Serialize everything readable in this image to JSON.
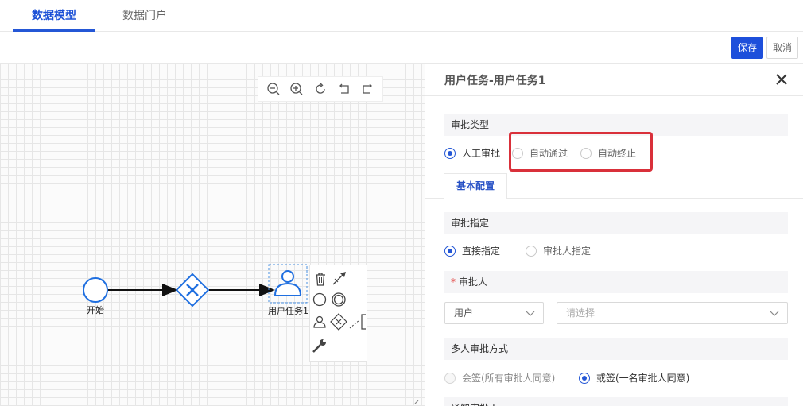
{
  "top_tabs": [
    {
      "label": "数据模型",
      "active": true
    },
    {
      "label": "数据门户",
      "active": false
    }
  ],
  "actions": {
    "save_label": "保存",
    "cancel_label": "取消"
  },
  "canvas": {
    "zoom_tools": [
      "zoom-out-icon",
      "zoom-in-icon",
      "reset-icon",
      "undo-icon",
      "redo-icon"
    ],
    "nodes": {
      "start_label": "开始",
      "task_label": "用户任务1"
    },
    "context_pad_icons": [
      "delete-icon",
      "connect-icon",
      "end-event-icon",
      "intermediate-event-icon",
      "user-task-icon",
      "gateway-icon",
      "annotation-icon",
      "wrench-icon"
    ]
  },
  "panel": {
    "title": "用户任务-用户任务1",
    "approval_type": {
      "label": "审批类型",
      "options": [
        "人工审批",
        "自动通过",
        "自动终止"
      ],
      "selected": "人工审批"
    },
    "sub_tab_label": "基本配置",
    "approval_assign": {
      "label": "审批指定",
      "options": [
        "直接指定",
        "审批人指定"
      ],
      "selected": "直接指定"
    },
    "approver": {
      "label": "审批人",
      "required_mark": "*",
      "type_value": "用户",
      "placeholder": "请选择"
    },
    "multi_approval": {
      "label": "多人审批方式",
      "options": [
        "会签(所有审批人同意)",
        "或签(一名审批人同意)"
      ],
      "selected": "或签(一名审批人同意)"
    },
    "next_section_label": "通知审批人"
  },
  "colors": {
    "accent": "#2457d6",
    "highlight": "#d9303a",
    "diagram_stroke": "#1f6fe0"
  }
}
